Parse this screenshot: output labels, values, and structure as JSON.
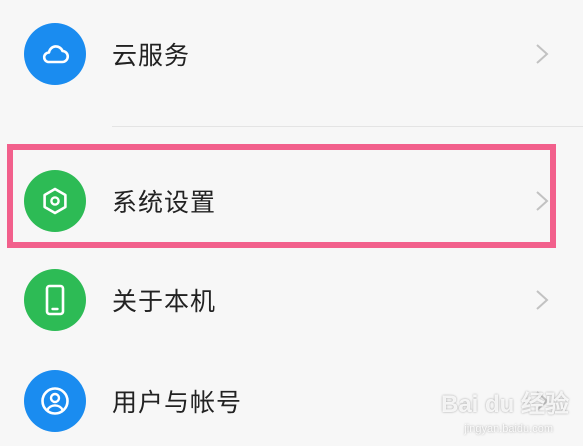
{
  "settings": {
    "items": [
      {
        "label": "云服务",
        "icon": "cloud-icon",
        "color": "#1a8cf0"
      },
      {
        "label": "系统设置",
        "icon": "hexagon-gear-icon",
        "color": "#2dbb55"
      },
      {
        "label": "关于本机",
        "icon": "phone-icon",
        "color": "#2dbb55"
      },
      {
        "label": "用户与帐号",
        "icon": "user-icon",
        "color": "#1a8cf0"
      }
    ]
  },
  "highlight": {
    "color": "#f2608c"
  },
  "watermark": {
    "text": "Bai du 经验",
    "subtext": "jingyan.baidu.com"
  }
}
